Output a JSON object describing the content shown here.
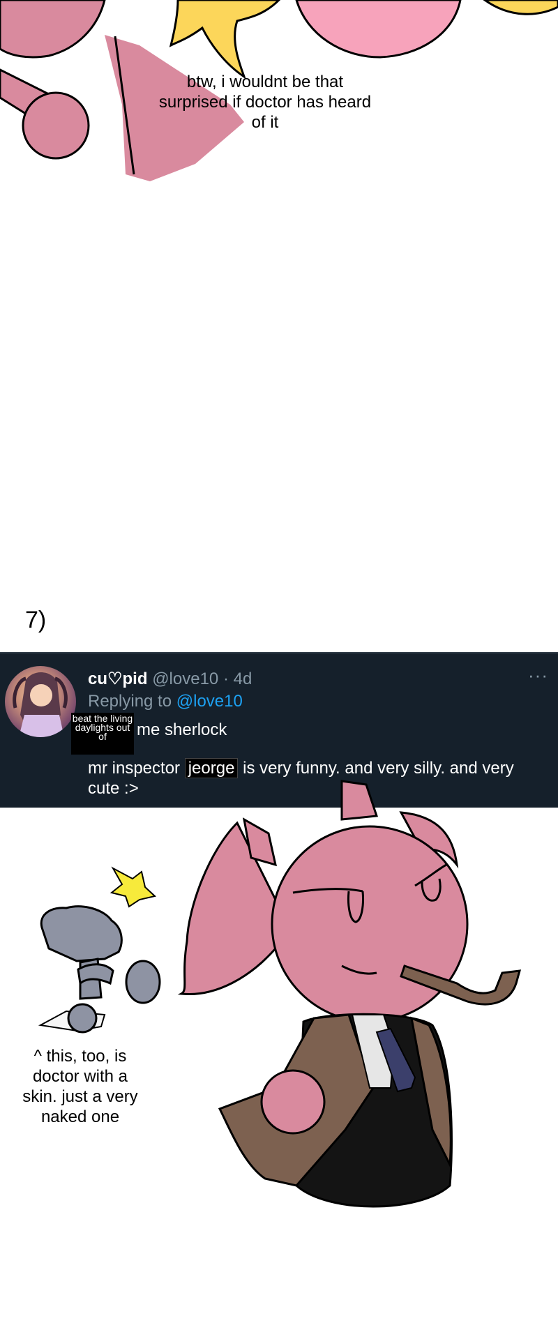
{
  "top_panel": {
    "caption": "btw, i wouldnt be that surprised if doctor has heard of it"
  },
  "section_number": "7)",
  "tweet": {
    "display_name": "cu♡pid",
    "handle_time": "@love10 · 4d",
    "more_icon": "···",
    "replying_label": "Replying to",
    "replying_handle": "@love10",
    "censor_text": "beat the living daylights out of",
    "line1": "me sherlock",
    "body_before": "mr inspector",
    "body_highlight": "jeorge",
    "body_after": "is very funny. and very silly. and very cute :>"
  },
  "bottom_panel": {
    "caption": "^ this, too, is doctor with a skin. just a very naked one"
  },
  "colors": {
    "pink": "#d98a9e",
    "light_pink": "#f7a3bb",
    "yellow": "#fcd65a",
    "tweet_bg": "#15202b",
    "brown": "#7d6150",
    "grey": "#8e93a3"
  }
}
